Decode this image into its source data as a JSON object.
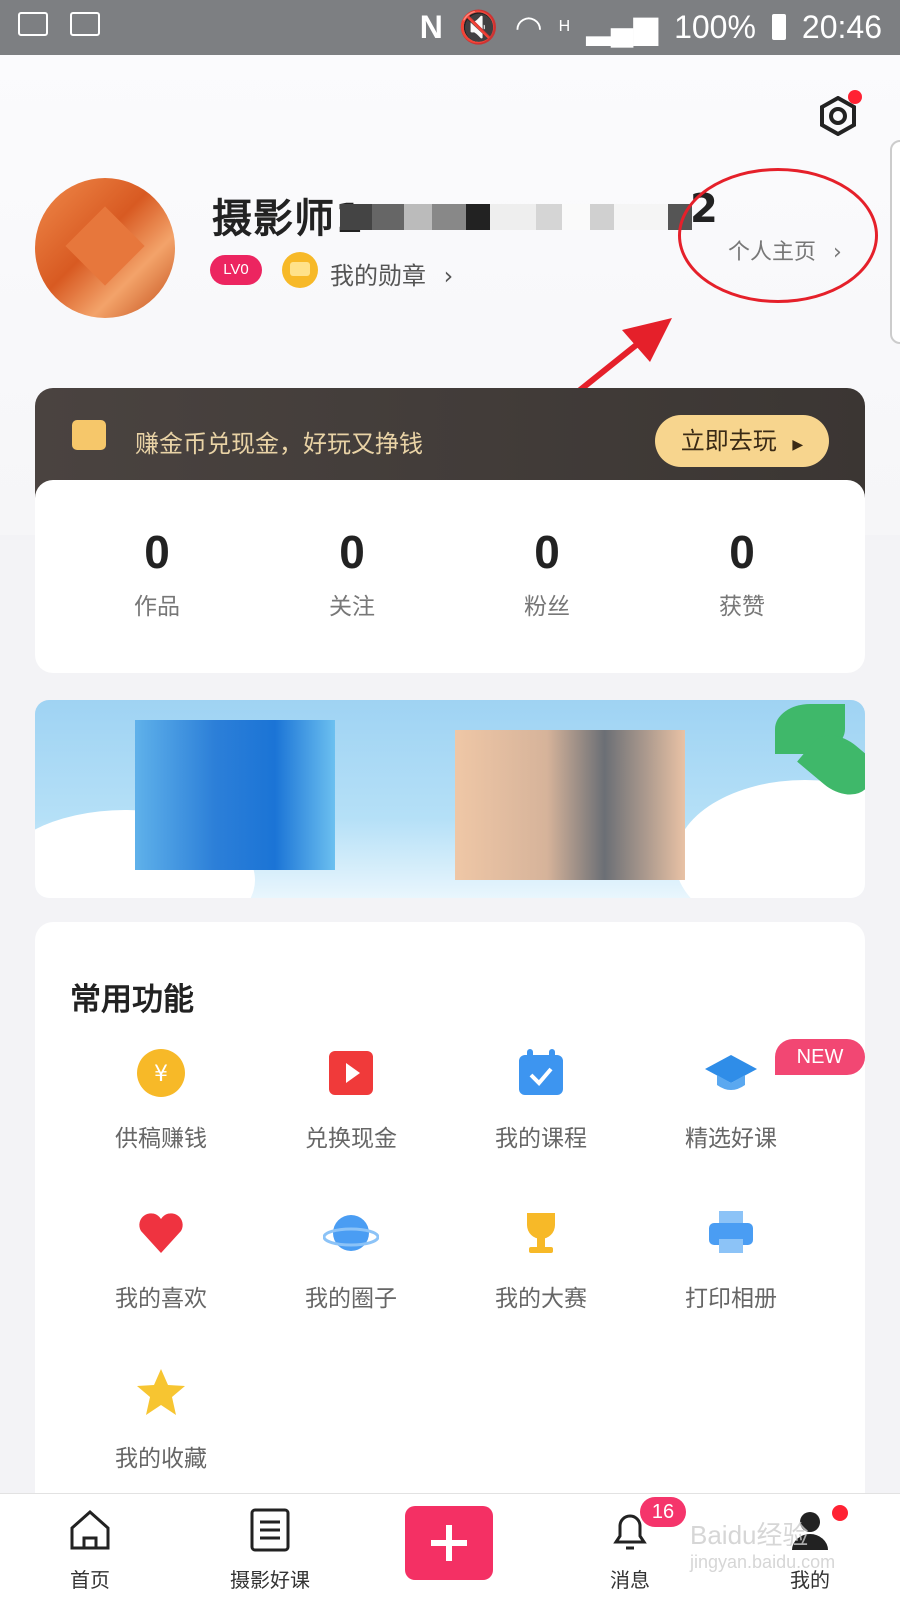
{
  "status_bar": {
    "battery": "100%",
    "time": "20:46",
    "network": "H"
  },
  "profile": {
    "username_visible_prefix": "摄影师1",
    "username_visible_suffix": "2",
    "level": "LV0",
    "medal_label": "我的勋章",
    "homepage_link": "个人主页"
  },
  "promo": {
    "text": "赚金币兑现金，好玩又挣钱",
    "button": "立即去玩"
  },
  "stats": [
    {
      "value": "0",
      "label": "作品"
    },
    {
      "value": "0",
      "label": "关注"
    },
    {
      "value": "0",
      "label": "粉丝"
    },
    {
      "value": "0",
      "label": "获赞"
    }
  ],
  "functions": {
    "title": "常用功能",
    "new_badge": "NEW",
    "items": [
      {
        "label": "供稿赚钱",
        "icon": "coin-icon",
        "color": "#f7b928"
      },
      {
        "label": "兑换现金",
        "icon": "video-icon",
        "color": "#f03a3a"
      },
      {
        "label": "我的课程",
        "icon": "calendar-icon",
        "color": "#3d95f0"
      },
      {
        "label": "精选好课",
        "icon": "graduation-cap-icon",
        "color": "#2f8de8"
      },
      {
        "label": "我的喜欢",
        "icon": "heart-icon",
        "color": "#ef3340"
      },
      {
        "label": "我的圈子",
        "icon": "planet-icon",
        "color": "#4a9df3"
      },
      {
        "label": "我的大赛",
        "icon": "trophy-icon",
        "color": "#f7b928"
      },
      {
        "label": "打印相册",
        "icon": "printer-icon",
        "color": "#4a9df3"
      },
      {
        "label": "我的收藏",
        "icon": "star-icon",
        "color": "#f7c531"
      }
    ]
  },
  "tabbar": {
    "home": "首页",
    "courses": "摄影好课",
    "messages": "消息",
    "messages_badge": "16",
    "me": "我的"
  },
  "watermark": {
    "brand": "Baidu经验",
    "url": "jingyan.baidu.com"
  },
  "colors": {
    "accent_pink": "#f43064",
    "promo_button": "#f7d58e",
    "annotation_red": "#e5202a"
  }
}
